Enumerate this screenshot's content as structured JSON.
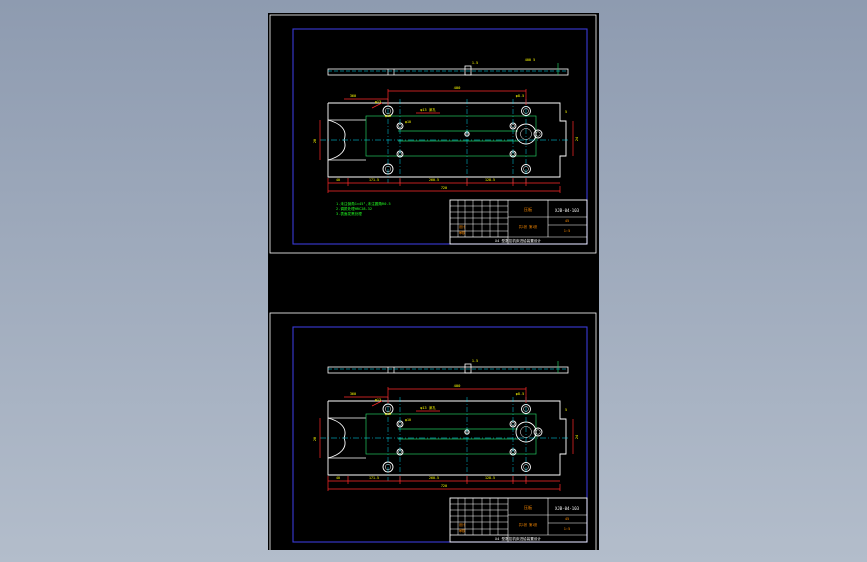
{
  "colors": {
    "background_top": "#8e9bb0",
    "background_bottom": "#b3bdcb",
    "canvas": "#000000",
    "sheet_border": "#ffffff",
    "frame": "#3a3ad8",
    "outline": "#ffffff",
    "dimension": "#ff2a2a",
    "centerline": "#00e5ff",
    "hidden_line": "#22c55e",
    "dim_text": "#ffff00",
    "note_text": "#22ff22",
    "titleblock_text": "#ff8c00"
  },
  "sheets": [
    {
      "dimensions": {
        "top_span": "400",
        "left_top": "360",
        "hole_top": "φ13",
        "top_right": "φ8.5",
        "callout": "φ13 深孔",
        "mid_hole": "φ18",
        "mid_small": "φ10",
        "left_height": "20",
        "right_height": "24",
        "bottom_a": "40",
        "bottom_b": "171.5",
        "bottom_c": "260.5",
        "bottom_d": "128.5",
        "bottom_total": "720",
        "right_side": "5",
        "top_view": "400 5",
        "top_mark": "1.5"
      },
      "notes": [
        "1.未注倒角1×45°,未注圆角R0.5",
        "2.调质处理HRC28-32",
        "3.表面发黑处理"
      ],
      "titleblock": {
        "drawing_no": "XJB-04-103",
        "part_name": "压板",
        "material": "45",
        "scale": "1:5",
        "designer": "设计",
        "checker": "审核",
        "sheet_info": "共1张 第1张",
        "school": "X4 型数控机床进给装置设计"
      }
    },
    {
      "dimensions": {
        "top_span": "400",
        "left_top": "360",
        "hole_top": "φ13",
        "top_right": "φ8.5",
        "callout": "φ13 深孔",
        "mid_hole": "φ18",
        "mid_small": "φ10",
        "left_height": "20",
        "right_height": "24",
        "bottom_a": "40",
        "bottom_b": "171.5",
        "bottom_c": "260.5",
        "bottom_d": "128.5",
        "bottom_total": "720",
        "right_side": "5",
        "top_view": "",
        "top_mark": "1.5"
      },
      "notes": [],
      "titleblock": {
        "drawing_no": "XJB-04-103",
        "part_name": "压板",
        "material": "45",
        "scale": "1:5",
        "designer": "设计",
        "checker": "审核",
        "sheet_info": "共1张 第1张",
        "school": "X4 型数控机床进给装置设计"
      }
    }
  ]
}
